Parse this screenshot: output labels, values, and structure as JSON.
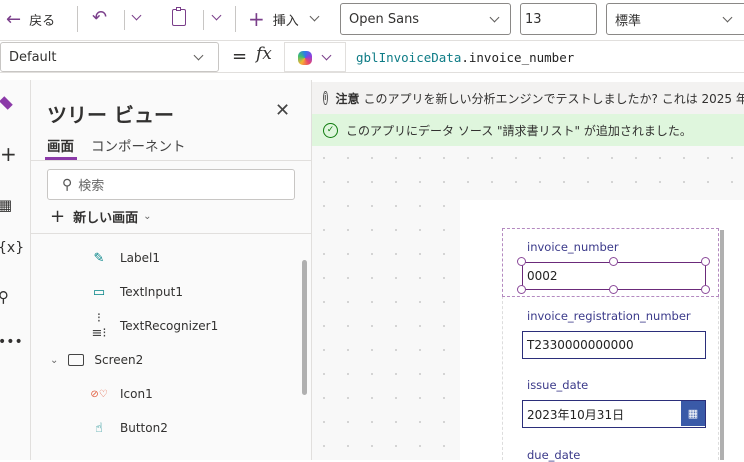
{
  "toolbar": {
    "back_label": "戻る",
    "insert_label": "挿入",
    "font": "Open Sans",
    "font_size": "13",
    "font_weight": "標準"
  },
  "formula_bar": {
    "property": "Default",
    "equals": "=",
    "fx": "fx",
    "formula_var": "gblInvoiceData",
    "formula_rest": ".invoice_number"
  },
  "tree_view": {
    "title": "ツリー ビュー",
    "tabs": [
      {
        "label": "画面"
      },
      {
        "label": "コンポーネント"
      }
    ],
    "search_placeholder": "検索",
    "new_screen_label": "新しい画面",
    "items": [
      {
        "label": "Label1"
      },
      {
        "label": "TextInput1"
      },
      {
        "label": "TextRecognizer1"
      },
      {
        "label": "Screen2"
      },
      {
        "label": "Icon1"
      },
      {
        "label": "Button2"
      }
    ]
  },
  "notices": {
    "info_bold": "注意",
    "info_text": "このアプリを新しい分析エンジンでテストしましたか? これは 2025 年",
    "success_text": "このアプリにデータ ソース \"請求書リスト\" が追加されました。"
  },
  "form": {
    "fields": [
      {
        "label": "invoice_number",
        "value": "0002"
      },
      {
        "label": "invoice_registration_number",
        "value": "T2330000000000"
      },
      {
        "label": "issue_date",
        "value": "2023年10月31日"
      },
      {
        "label": "due_date"
      }
    ]
  },
  "colors": {
    "accent": "#742774",
    "success_bg": "#dff6dd",
    "info_bg": "#f3f2f1",
    "calendar_btn": "#3a5aa8"
  }
}
